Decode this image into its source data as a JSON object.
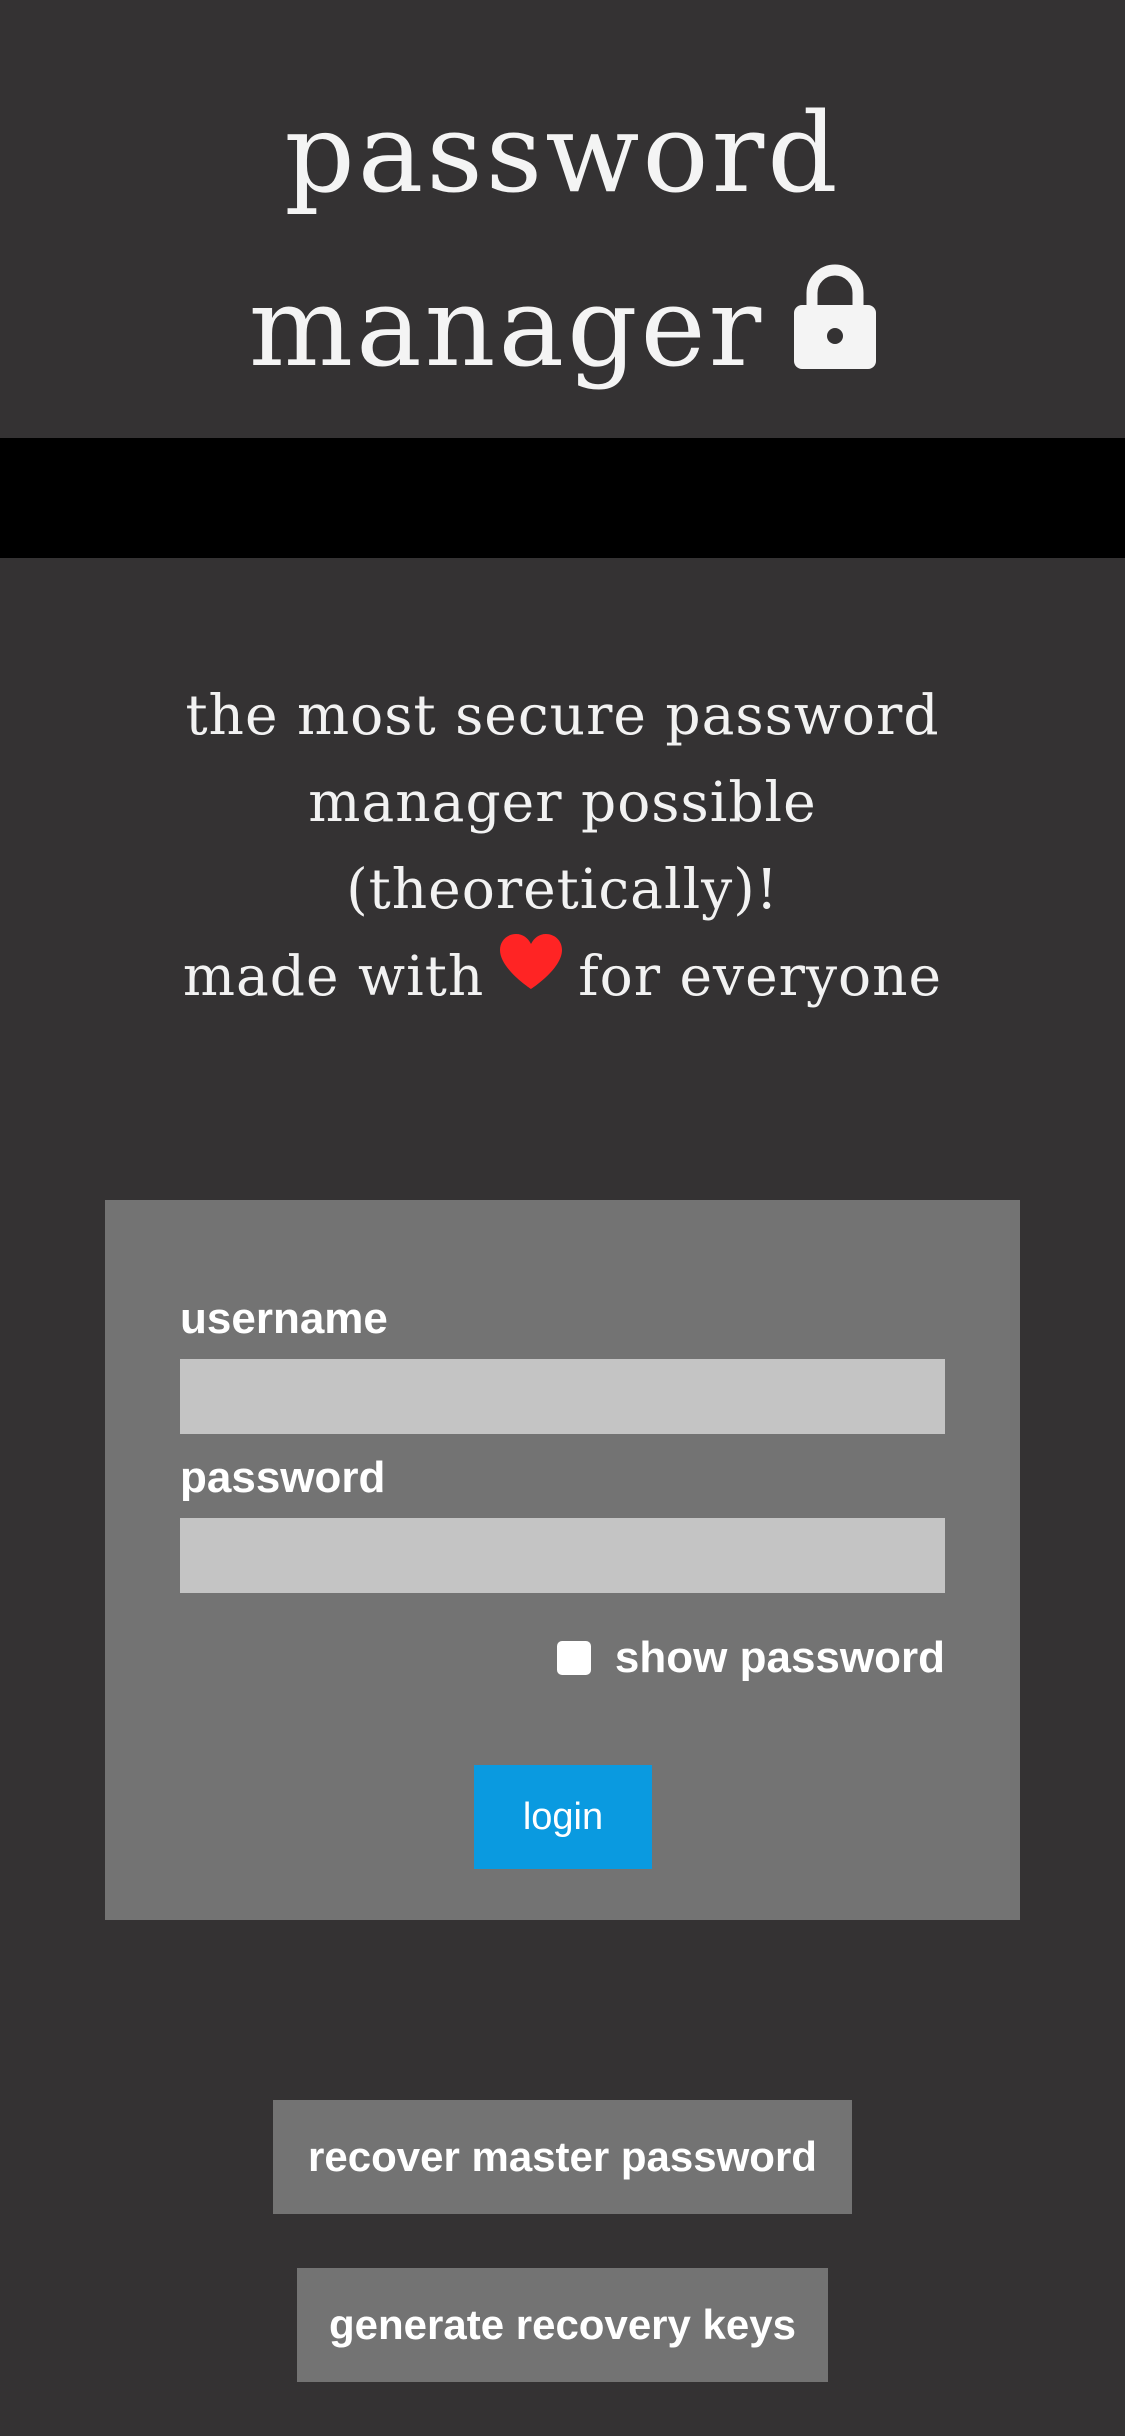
{
  "header": {
    "title_line1": "password",
    "title_line2": "manager",
    "lock_icon": "lock-icon"
  },
  "tagline": {
    "line1": "the most secure password",
    "line2": "manager possible",
    "line3": "(theoretically)!",
    "line4_before": "made with",
    "heart_icon": "heart-icon",
    "heart_color": "#ff2424",
    "line4_after": "for everyone"
  },
  "login_form": {
    "username_label": "username",
    "username_value": "",
    "password_label": "password",
    "password_value": "",
    "show_password_label": "show password",
    "show_password_checked": false,
    "login_label": "login",
    "login_color": "#0a9ae0"
  },
  "actions": {
    "recover_label": "recover master password",
    "generate_label": "generate recovery keys"
  },
  "colors": {
    "background": "#343233",
    "card": "#737373",
    "input": "#c4c4c4",
    "bar": "#000000"
  }
}
